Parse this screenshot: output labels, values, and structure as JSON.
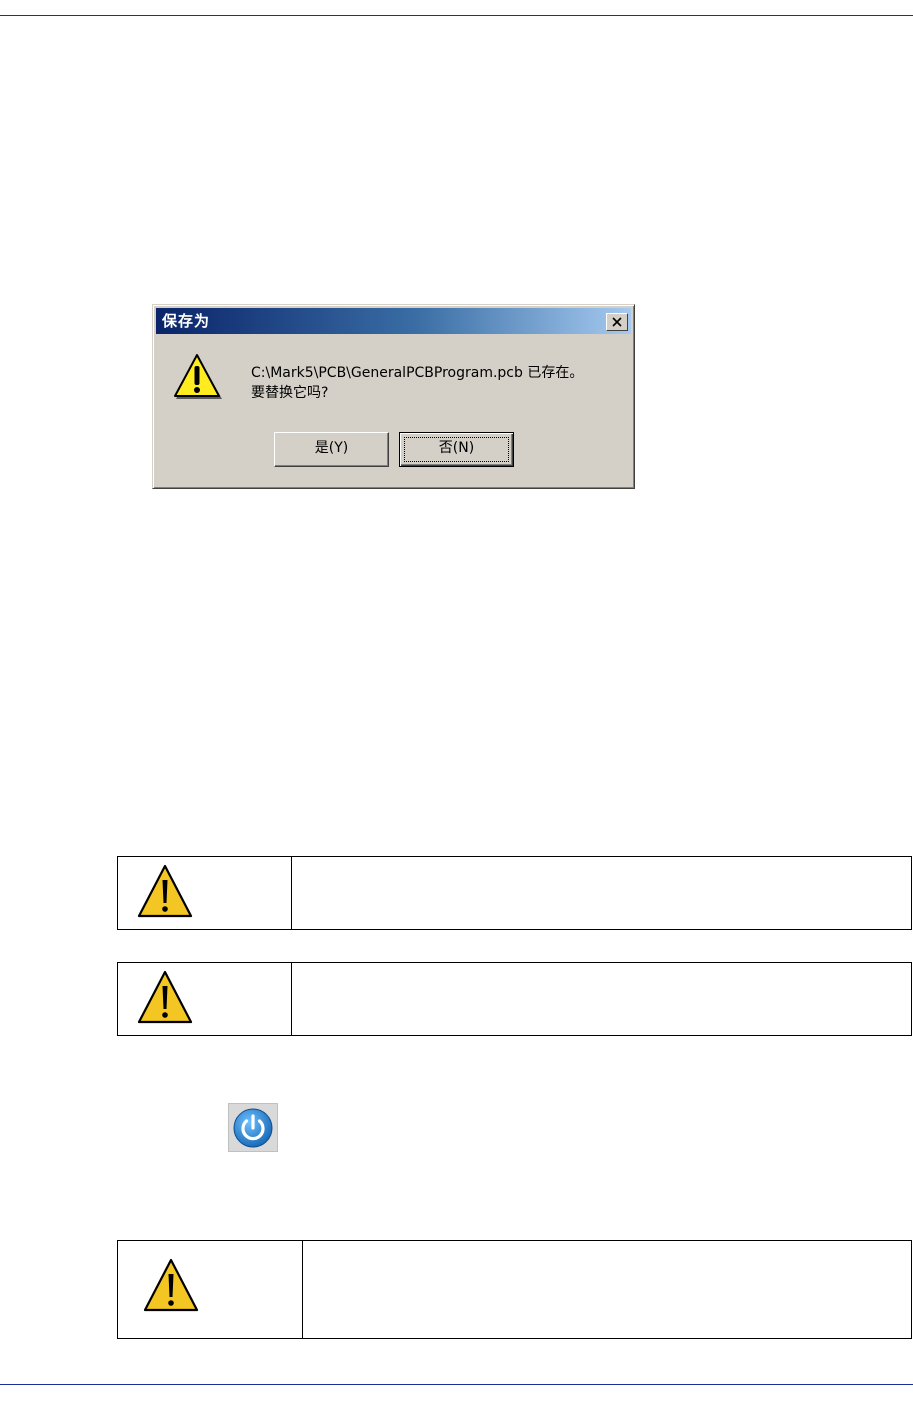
{
  "dialog": {
    "title": "保存为",
    "message_line1": "C:\\Mark5\\PCB\\GeneralPCBProgram.pcb 已存在。",
    "message_line2": "要替换它吗?",
    "yes_label": "是(Y)",
    "no_label": "否(N)",
    "icon": "warning-icon",
    "close_icon": "close-icon"
  },
  "warnings": [
    {
      "icon": "warning-triangle-icon",
      "text": ""
    },
    {
      "icon": "warning-triangle-icon",
      "text": ""
    },
    {
      "icon": "warning-triangle-icon",
      "text": ""
    }
  ],
  "power_button": {
    "icon": "power-icon"
  },
  "colors": {
    "rule": "#1f2f9a",
    "dialog_bg": "#d4d0c8",
    "title_start": "#0a246a",
    "title_end": "#a6caf0",
    "warning_fill": "#f3c623",
    "power_blue": "#1f7fc6"
  }
}
